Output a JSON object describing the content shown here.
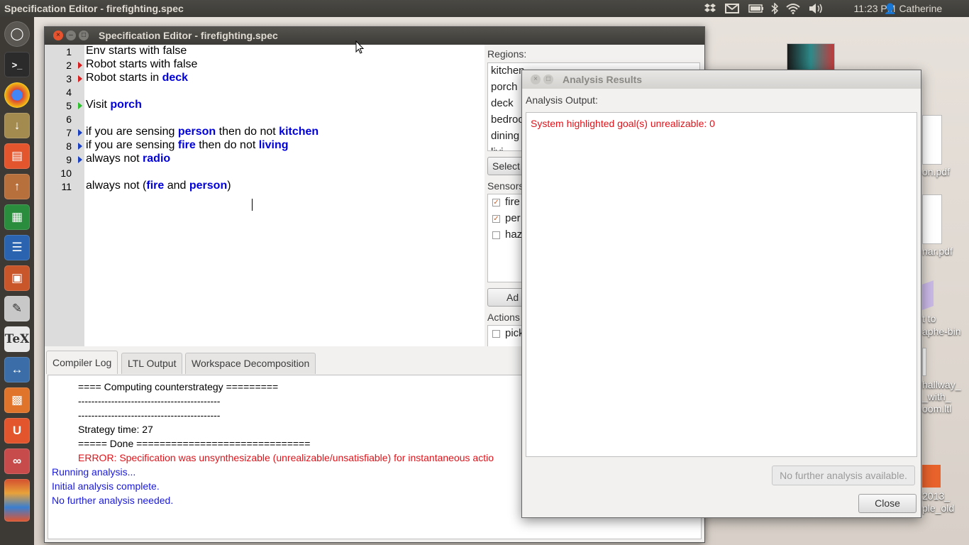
{
  "top_panel": {
    "active_app_title": "Specification Editor - firefighting.spec",
    "clock": "11:23 PM",
    "user": "Catherine"
  },
  "launcher": {
    "items": [
      "dash",
      "terminal",
      "chrome",
      "archive-manager",
      "files",
      "software-updater",
      "calc",
      "writer",
      "impress",
      "text-editor",
      "tex",
      "network",
      "software-center",
      "ubuntu-one",
      "misc"
    ]
  },
  "desktop": {
    "labels": [
      "on.pdf",
      "nar.pdf",
      "t to",
      "aphe-bin",
      "hallway_",
      "_with_",
      "oom.ltl",
      "2013_",
      "ple_old"
    ]
  },
  "main_window": {
    "title": "Specification Editor - firefighting.spec",
    "editor": {
      "line_numbers": [
        "1",
        "2",
        "3",
        "4",
        "5",
        "6",
        "7",
        "8",
        "9",
        "10",
        "11"
      ],
      "lines": [
        [
          {
            "t": "Env starts with false",
            "k": false
          }
        ],
        [
          {
            "t": "Robot starts with false",
            "k": false
          }
        ],
        [
          {
            "t": "Robot starts in ",
            "k": false
          },
          {
            "t": "deck",
            "k": true
          }
        ],
        [],
        [
          {
            "t": "Visit ",
            "k": false
          },
          {
            "t": "porch",
            "k": true
          }
        ],
        [],
        [
          {
            "t": "if you are sensing ",
            "k": false
          },
          {
            "t": "person",
            "k": true
          },
          {
            "t": " then do not ",
            "k": false
          },
          {
            "t": "kitchen",
            "k": true
          }
        ],
        [
          {
            "t": "if you are sensing ",
            "k": false
          },
          {
            "t": "fire",
            "k": true
          },
          {
            "t": " then do not ",
            "k": false
          },
          {
            "t": "living",
            "k": true
          }
        ],
        [
          {
            "t": "always not ",
            "k": false
          },
          {
            "t": "radio",
            "k": true
          }
        ],
        [],
        [
          {
            "t": "always not (",
            "k": false
          },
          {
            "t": "fire",
            "k": true
          },
          {
            "t": " and ",
            "k": false
          },
          {
            "t": "person",
            "k": true
          },
          {
            "t": ")",
            "k": false
          }
        ]
      ]
    },
    "regions_label": "Regions:",
    "regions": [
      "kitchen",
      "porch",
      "deck",
      "bedroc",
      "dining",
      "livi"
    ],
    "select_button": "Select",
    "sensors_label": "Sensors",
    "sensors": [
      {
        "label": "fire",
        "checked": true
      },
      {
        "label": "per",
        "checked": true
      },
      {
        "label": "haz",
        "checked": false
      }
    ],
    "add_button": "Ad",
    "actions_label": "Actions",
    "actions": [
      {
        "label": "pick",
        "checked": false
      }
    ],
    "tabs": [
      "Compiler Log",
      "LTL Output",
      "Workspace Decomposition"
    ],
    "log_lines": [
      {
        "text": "==== Computing counterstrategy =========",
        "color": "#000000"
      },
      {
        "text": "-------------------------------------------",
        "color": "#000000"
      },
      {
        "text": "-------------------------------------------",
        "color": "#000000"
      },
      {
        "text": "Strategy time: 27",
        "color": "#000000"
      },
      {
        "text": "===== Done ==============================",
        "color": "#000000"
      },
      {
        "text": "ERROR: Specification was unsynthesizable (unrealizable/unsatisfiable) for instantaneous actio",
        "color": "#e0131a"
      },
      {
        "text": "Running analysis...",
        "color": "#1a1ad6"
      },
      {
        "text": "Initial analysis complete.",
        "color": "#1a1ad6"
      },
      {
        "text": "No further analysis needed.",
        "color": "#1a1ad6"
      }
    ]
  },
  "analysis_dialog": {
    "title": "Analysis Results",
    "output_label": "Analysis Output:",
    "output_text": "System highlighted goal(s) unrealizable: 0",
    "no_further_button": "No further analysis available.",
    "close_button": "Close"
  },
  "colors": {
    "keyword": "#0000dd",
    "error": "#e0131a",
    "info": "#1a1ad6"
  }
}
